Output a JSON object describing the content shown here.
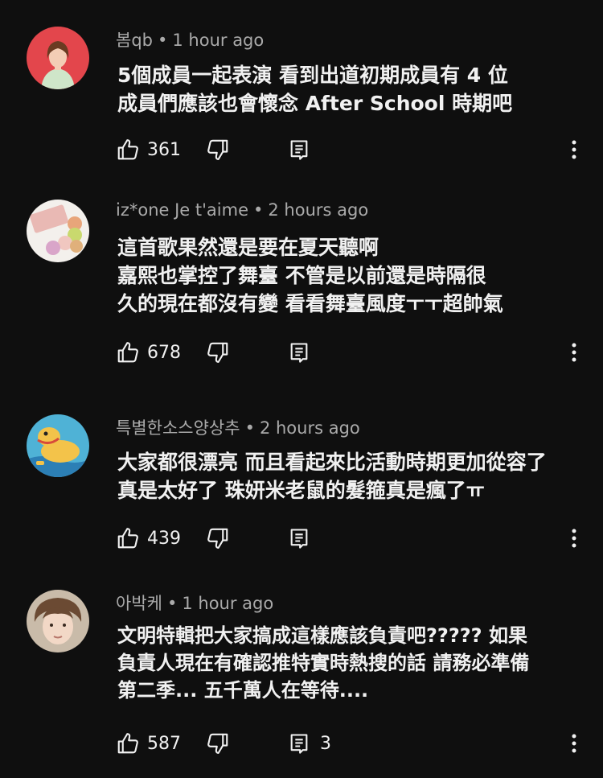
{
  "comments": [
    {
      "author": "봄qb",
      "time": "1 hour ago",
      "lines": [
        "5個成員一起表演 看到出道初期成員有 4 位",
        "成員們應該也會懷念 After School 時期吧"
      ],
      "likes": "361",
      "replies": ""
    },
    {
      "author": "iz*one Je t'aime",
      "time": "2 hours ago",
      "lines": [
        "這首歌果然還是要在夏天聽啊",
        "嘉熙也掌控了舞臺 不管是以前還是時隔很",
        "久的現在都沒有變 看看舞臺風度ㅜㅜ超帥氣"
      ],
      "likes": "678",
      "replies": ""
    },
    {
      "author": "특별한소스양상추",
      "time": "2 hours ago",
      "lines": [
        "大家都很漂亮 而且看起來比活動時期更加從容了",
        "真是太好了 珠妍米老鼠的髮箍真是瘋了ㅠ"
      ],
      "likes": "439",
      "replies": ""
    },
    {
      "author": "아박케",
      "time": "1 hour ago",
      "lines": [
        "文明特輯把大家搞成這樣應該負責吧????? 如果",
        "負責人現在有確認推特實時熱搜的話 請務必準備",
        "第二季... 五千萬人在等待...."
      ],
      "likes": "587",
      "replies": "3"
    }
  ],
  "meta_separator": "•",
  "icons": {
    "like": "thumbs-up-icon",
    "dislike": "thumbs-down-icon",
    "reply": "reply-comment-icon",
    "more": "more-vertical-icon"
  },
  "colors": {
    "background": "#0f0f0f",
    "text": "#f1f1f1",
    "meta": "#aaaaaa"
  }
}
